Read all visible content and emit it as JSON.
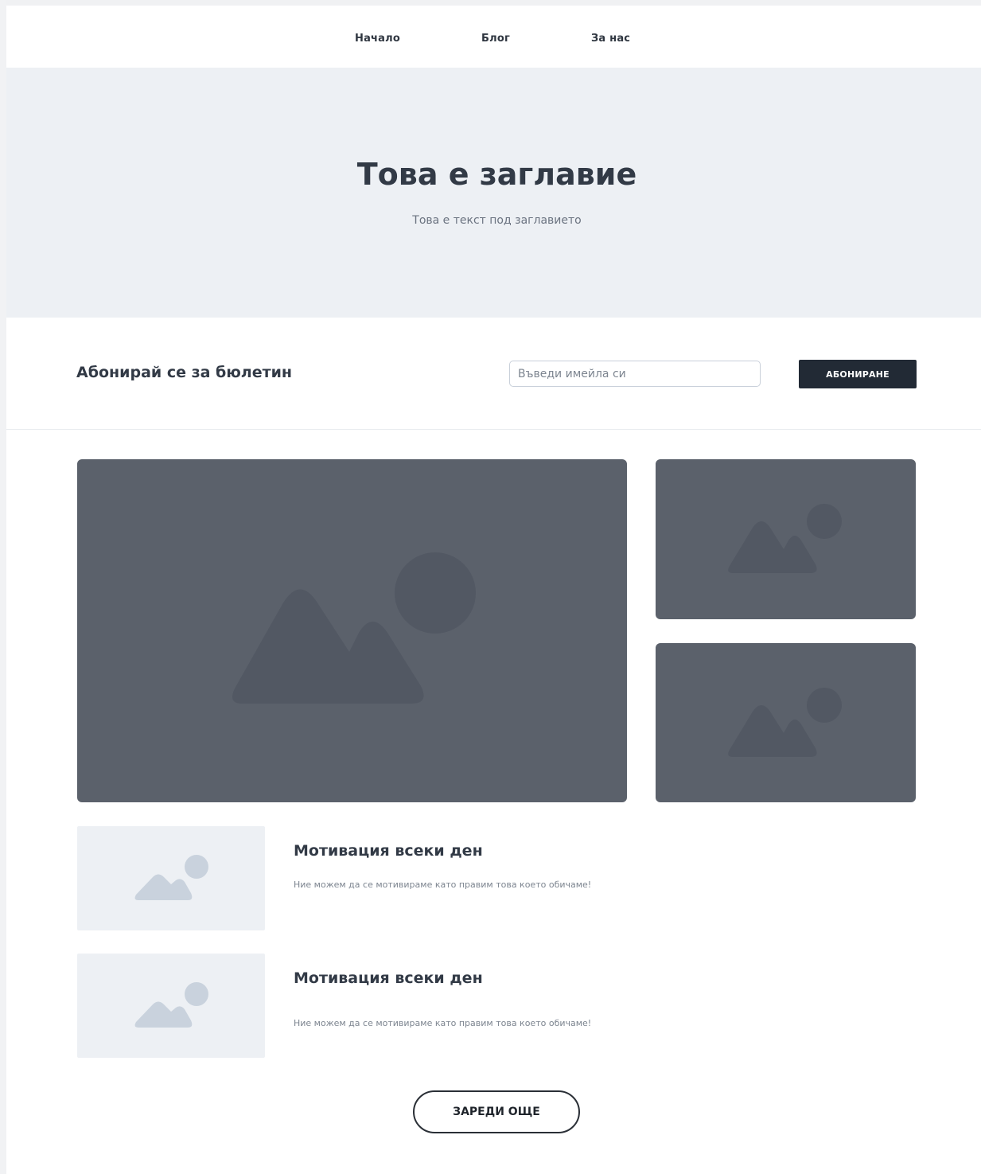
{
  "nav": {
    "items": [
      {
        "label": "Начало"
      },
      {
        "label": "Блог"
      },
      {
        "label": "За нас"
      }
    ]
  },
  "hero": {
    "title": "Това е заглавие",
    "subtitle": "Това е текст под заглавието"
  },
  "newsletter": {
    "heading": "Абонирай се за бюлетин",
    "email_placeholder": "Въведи имейла си",
    "email_value": "",
    "subscribe_label": "АБОНИРАНЕ"
  },
  "gallery": {
    "images": [
      {
        "icon": "image-placeholder-icon"
      },
      {
        "icon": "image-placeholder-icon"
      },
      {
        "icon": "image-placeholder-icon"
      }
    ]
  },
  "articles": [
    {
      "title": "Мотивация всеки ден",
      "text": "Ние можем да се мотивираме като правим това което обичаме!",
      "icon": "image-placeholder-icon"
    },
    {
      "title": "Мотивация всеки ден",
      "text": "Ние можем да се мотивираме като правим това което обичаме!",
      "icon": "image-placeholder-icon"
    }
  ],
  "load_more": {
    "label": "ЗАРЕДИ ОЩЕ"
  },
  "colors": {
    "hero_bg": "#edf0f4",
    "dark_image_bg": "#5b616b",
    "dark_icon": "#525863",
    "light_icon": "#c9d2dd",
    "button_dark": "#222a35",
    "text_dark": "#323a46",
    "text_muted": "#7d8590"
  }
}
